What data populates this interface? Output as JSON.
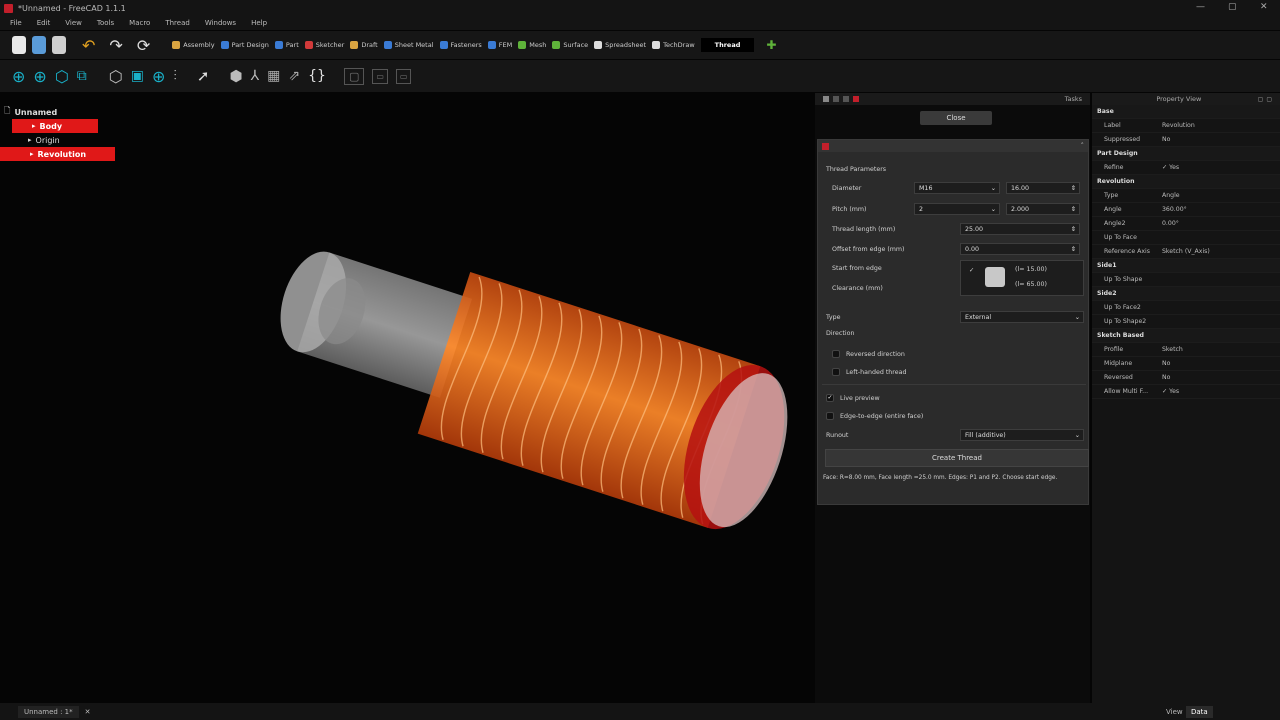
{
  "window": {
    "title": "*Unnamed - FreeCAD 1.1.1"
  },
  "menu": [
    "File",
    "Edit",
    "View",
    "Tools",
    "Macro",
    "Thread",
    "Windows",
    "Help"
  ],
  "workbenches": [
    {
      "label": "Assembly",
      "color": "#d9a441"
    },
    {
      "label": "Part Design",
      "color": "#3a7bd5"
    },
    {
      "label": "Part",
      "color": "#3a7bd5"
    },
    {
      "label": "Sketcher",
      "color": "#d23a3a"
    },
    {
      "label": "Draft",
      "color": "#d9a441"
    },
    {
      "label": "Sheet Metal",
      "color": "#3a7bd5"
    },
    {
      "label": "Fasteners",
      "color": "#3a7bd5"
    },
    {
      "label": "FEM",
      "color": "#3a7bd5"
    },
    {
      "label": "Mesh",
      "color": "#5fb33a"
    },
    {
      "label": "Surface",
      "color": "#5fb33a"
    },
    {
      "label": "Spreadsheet",
      "color": "#dddddd"
    },
    {
      "label": "TechDraw",
      "color": "#dddddd"
    },
    {
      "label": "Thread",
      "color": "#ffffff",
      "active": true
    }
  ],
  "tree": {
    "document": "Unnamed",
    "items": [
      {
        "label": "Body",
        "selected": true,
        "indent": 1
      },
      {
        "label": "Origin",
        "selected": false,
        "indent": 2
      },
      {
        "label": "Revolution",
        "selected": true,
        "indent": 2
      }
    ]
  },
  "tasks": {
    "title": "Tasks",
    "close_label": "Close"
  },
  "thread": {
    "section": "Thread Parameters",
    "diameter_label": "Diameter",
    "diameter_preset": "M16",
    "diameter_value": "16.00",
    "pitch_label": "Pitch (mm)",
    "pitch_preset": "2",
    "pitch_value": "2.000",
    "length_label": "Thread length (mm)",
    "length_value": "25.00",
    "offset_label": "Offset from edge (mm)",
    "offset_value": "0.00",
    "start_label": "Start from edge",
    "clearance_label": "Clearance (mm)",
    "edge1": "(l= 15.00)",
    "edge2": "(l= 65.00)",
    "type_label": "Type",
    "type_value": "External",
    "direction_label": "Direction",
    "reversed_label": "Reversed direction",
    "lefthand_label": "Left-handed thread",
    "live_label": "Live preview",
    "edge_label": "Edge-to-edge (entire face)",
    "runout_label": "Runout",
    "runout_value": "Fill (additive)",
    "create_label": "Create Thread",
    "status": "Face: R=8.00 mm, Face length =25.0 mm. Edges: P1 and P2. Choose start edge."
  },
  "property_view": {
    "title": "Property View",
    "rows": [
      {
        "group": "Base"
      },
      {
        "k": "Label",
        "v": "Revolution"
      },
      {
        "k": "Suppressed",
        "v": "No"
      },
      {
        "group": "Part Design"
      },
      {
        "k": "Refine",
        "v": "Yes",
        "check": true
      },
      {
        "group": "Revolution"
      },
      {
        "k": "Type",
        "v": "Angle"
      },
      {
        "k": "Angle",
        "v": "360.00°"
      },
      {
        "k": "Angle2",
        "v": "0.00°"
      },
      {
        "k": "Up To Face",
        "v": ""
      },
      {
        "k": "Reference Axis",
        "v": "Sketch (V_Axis)"
      },
      {
        "group": "Side1"
      },
      {
        "k": "Up To Shape",
        "v": ""
      },
      {
        "group": "Side2"
      },
      {
        "k": "Up To Face2",
        "v": ""
      },
      {
        "k": "Up To Shape2",
        "v": ""
      },
      {
        "group": "Sketch Based"
      },
      {
        "k": "Profile",
        "v": "Sketch"
      },
      {
        "k": "Midplane",
        "v": "No"
      },
      {
        "k": "Reversed",
        "v": "No"
      },
      {
        "k": "Allow Multi F...",
        "v": "Yes",
        "check": true
      }
    ],
    "tabs": [
      "View",
      "Data"
    ]
  },
  "status_tab": "Unnamed : 1*"
}
